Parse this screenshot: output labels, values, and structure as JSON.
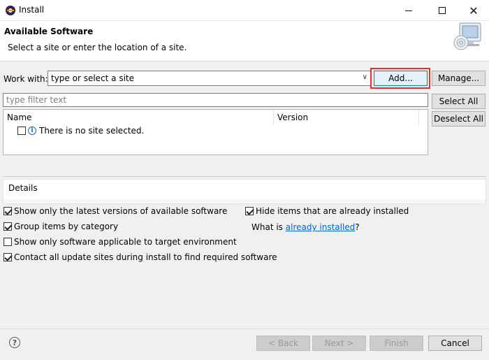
{
  "window": {
    "title": "Install"
  },
  "banner": {
    "title": "Available Software",
    "subtitle": "Select a site or enter the location of a site."
  },
  "work_with": {
    "label": "Work with:",
    "value": "type or select a site",
    "add_label": "Add...",
    "manage_label": "Manage..."
  },
  "filter": {
    "placeholder": "type filter text"
  },
  "buttons": {
    "select_all": "Select All",
    "deselect_all": "Deselect All",
    "back": "< Back",
    "next": "Next >",
    "finish": "Finish",
    "cancel": "Cancel"
  },
  "tree": {
    "columns": [
      "Name",
      "Version"
    ],
    "message": "There is no site selected."
  },
  "details": {
    "label": "Details"
  },
  "options": {
    "latest_versions": {
      "label": "Show only the latest versions of available software",
      "checked": true
    },
    "group_by_category": {
      "label": "Group items by category",
      "checked": true
    },
    "target_env": {
      "label": "Show only software applicable to target environment",
      "checked": false
    },
    "contact_sites": {
      "label": "Contact all update sites during install to find required software",
      "checked": true
    },
    "hide_installed": {
      "label": "Hide items that are already installed",
      "checked": true
    }
  },
  "whatis": {
    "prefix": "What is ",
    "link": "already installed",
    "suffix": "?"
  },
  "colors": {
    "highlight_border": "#e03030",
    "link": "#0066cc"
  }
}
